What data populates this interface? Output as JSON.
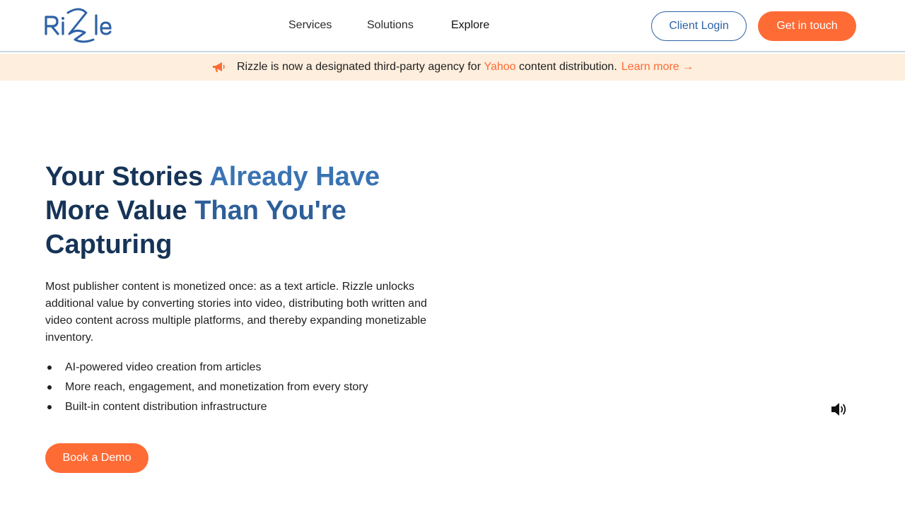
{
  "brand": {
    "logo_text": "Rizzle",
    "primary_color": "#2e62a5",
    "accent_color": "#ff6b35"
  },
  "nav": {
    "items": [
      {
        "label": "Services"
      },
      {
        "label": "Solutions"
      },
      {
        "label": "Explore"
      }
    ]
  },
  "header_actions": {
    "client_login": "Client Login",
    "get_in_touch": "Get in touch"
  },
  "announcement": {
    "icon": "megaphone-icon",
    "text_before": "Rizzle is now a designated third-party agency for",
    "highlight": "Yahoo",
    "text_after": "content distribution.",
    "link": "Learn more →",
    "background": "#fdeedd"
  },
  "hero": {
    "title_parts": [
      {
        "text": "Your Stories ",
        "style": "dark"
      },
      {
        "text": "Already Have",
        "style": "accent"
      },
      {
        "text": "More Value ",
        "style": "dark"
      },
      {
        "text": "Than You're",
        "style": "accent"
      },
      {
        "text": "Capturing",
        "style": "dark"
      }
    ],
    "description": "Most publisher content is monetized once: as a text article. Rizzle unlocks additional value by converting stories into video, distributing both written and video content across multiple platforms, and thereby expanding monetizable inventory.",
    "bullets": [
      "AI-powered video creation from articles",
      "More reach, engagement, and monetization from every story",
      "Built-in content distribution infrastructure"
    ],
    "cta": "Book a Demo"
  },
  "media": {
    "speaker_icon": "speaker-icon"
  }
}
